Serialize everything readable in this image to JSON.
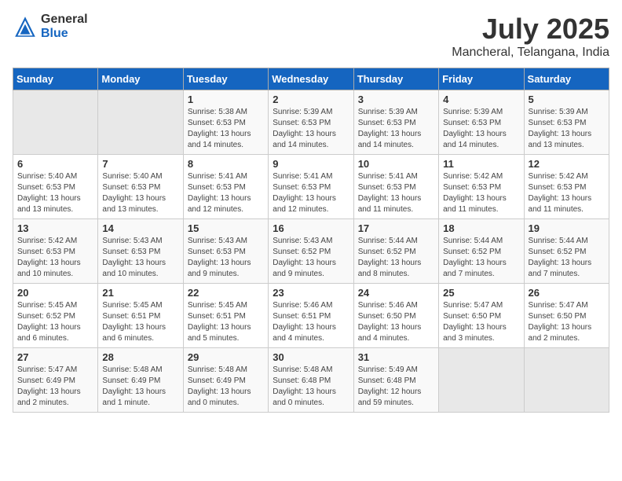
{
  "logo": {
    "general": "General",
    "blue": "Blue"
  },
  "title": {
    "month": "July 2025",
    "location": "Mancheral, Telangana, India"
  },
  "headers": [
    "Sunday",
    "Monday",
    "Tuesday",
    "Wednesday",
    "Thursday",
    "Friday",
    "Saturday"
  ],
  "weeks": [
    [
      {
        "day": "",
        "info": ""
      },
      {
        "day": "",
        "info": ""
      },
      {
        "day": "1",
        "info": "Sunrise: 5:38 AM\nSunset: 6:53 PM\nDaylight: 13 hours\nand 14 minutes."
      },
      {
        "day": "2",
        "info": "Sunrise: 5:39 AM\nSunset: 6:53 PM\nDaylight: 13 hours\nand 14 minutes."
      },
      {
        "day": "3",
        "info": "Sunrise: 5:39 AM\nSunset: 6:53 PM\nDaylight: 13 hours\nand 14 minutes."
      },
      {
        "day": "4",
        "info": "Sunrise: 5:39 AM\nSunset: 6:53 PM\nDaylight: 13 hours\nand 14 minutes."
      },
      {
        "day": "5",
        "info": "Sunrise: 5:39 AM\nSunset: 6:53 PM\nDaylight: 13 hours\nand 13 minutes."
      }
    ],
    [
      {
        "day": "6",
        "info": "Sunrise: 5:40 AM\nSunset: 6:53 PM\nDaylight: 13 hours\nand 13 minutes."
      },
      {
        "day": "7",
        "info": "Sunrise: 5:40 AM\nSunset: 6:53 PM\nDaylight: 13 hours\nand 13 minutes."
      },
      {
        "day": "8",
        "info": "Sunrise: 5:41 AM\nSunset: 6:53 PM\nDaylight: 13 hours\nand 12 minutes."
      },
      {
        "day": "9",
        "info": "Sunrise: 5:41 AM\nSunset: 6:53 PM\nDaylight: 13 hours\nand 12 minutes."
      },
      {
        "day": "10",
        "info": "Sunrise: 5:41 AM\nSunset: 6:53 PM\nDaylight: 13 hours\nand 11 minutes."
      },
      {
        "day": "11",
        "info": "Sunrise: 5:42 AM\nSunset: 6:53 PM\nDaylight: 13 hours\nand 11 minutes."
      },
      {
        "day": "12",
        "info": "Sunrise: 5:42 AM\nSunset: 6:53 PM\nDaylight: 13 hours\nand 11 minutes."
      }
    ],
    [
      {
        "day": "13",
        "info": "Sunrise: 5:42 AM\nSunset: 6:53 PM\nDaylight: 13 hours\nand 10 minutes."
      },
      {
        "day": "14",
        "info": "Sunrise: 5:43 AM\nSunset: 6:53 PM\nDaylight: 13 hours\nand 10 minutes."
      },
      {
        "day": "15",
        "info": "Sunrise: 5:43 AM\nSunset: 6:53 PM\nDaylight: 13 hours\nand 9 minutes."
      },
      {
        "day": "16",
        "info": "Sunrise: 5:43 AM\nSunset: 6:52 PM\nDaylight: 13 hours\nand 9 minutes."
      },
      {
        "day": "17",
        "info": "Sunrise: 5:44 AM\nSunset: 6:52 PM\nDaylight: 13 hours\nand 8 minutes."
      },
      {
        "day": "18",
        "info": "Sunrise: 5:44 AM\nSunset: 6:52 PM\nDaylight: 13 hours\nand 7 minutes."
      },
      {
        "day": "19",
        "info": "Sunrise: 5:44 AM\nSunset: 6:52 PM\nDaylight: 13 hours\nand 7 minutes."
      }
    ],
    [
      {
        "day": "20",
        "info": "Sunrise: 5:45 AM\nSunset: 6:52 PM\nDaylight: 13 hours\nand 6 minutes."
      },
      {
        "day": "21",
        "info": "Sunrise: 5:45 AM\nSunset: 6:51 PM\nDaylight: 13 hours\nand 6 minutes."
      },
      {
        "day": "22",
        "info": "Sunrise: 5:45 AM\nSunset: 6:51 PM\nDaylight: 13 hours\nand 5 minutes."
      },
      {
        "day": "23",
        "info": "Sunrise: 5:46 AM\nSunset: 6:51 PM\nDaylight: 13 hours\nand 4 minutes."
      },
      {
        "day": "24",
        "info": "Sunrise: 5:46 AM\nSunset: 6:50 PM\nDaylight: 13 hours\nand 4 minutes."
      },
      {
        "day": "25",
        "info": "Sunrise: 5:47 AM\nSunset: 6:50 PM\nDaylight: 13 hours\nand 3 minutes."
      },
      {
        "day": "26",
        "info": "Sunrise: 5:47 AM\nSunset: 6:50 PM\nDaylight: 13 hours\nand 2 minutes."
      }
    ],
    [
      {
        "day": "27",
        "info": "Sunrise: 5:47 AM\nSunset: 6:49 PM\nDaylight: 13 hours\nand 2 minutes."
      },
      {
        "day": "28",
        "info": "Sunrise: 5:48 AM\nSunset: 6:49 PM\nDaylight: 13 hours\nand 1 minute."
      },
      {
        "day": "29",
        "info": "Sunrise: 5:48 AM\nSunset: 6:49 PM\nDaylight: 13 hours\nand 0 minutes."
      },
      {
        "day": "30",
        "info": "Sunrise: 5:48 AM\nSunset: 6:48 PM\nDaylight: 13 hours\nand 0 minutes."
      },
      {
        "day": "31",
        "info": "Sunrise: 5:49 AM\nSunset: 6:48 PM\nDaylight: 12 hours\nand 59 minutes."
      },
      {
        "day": "",
        "info": ""
      },
      {
        "day": "",
        "info": ""
      }
    ]
  ]
}
